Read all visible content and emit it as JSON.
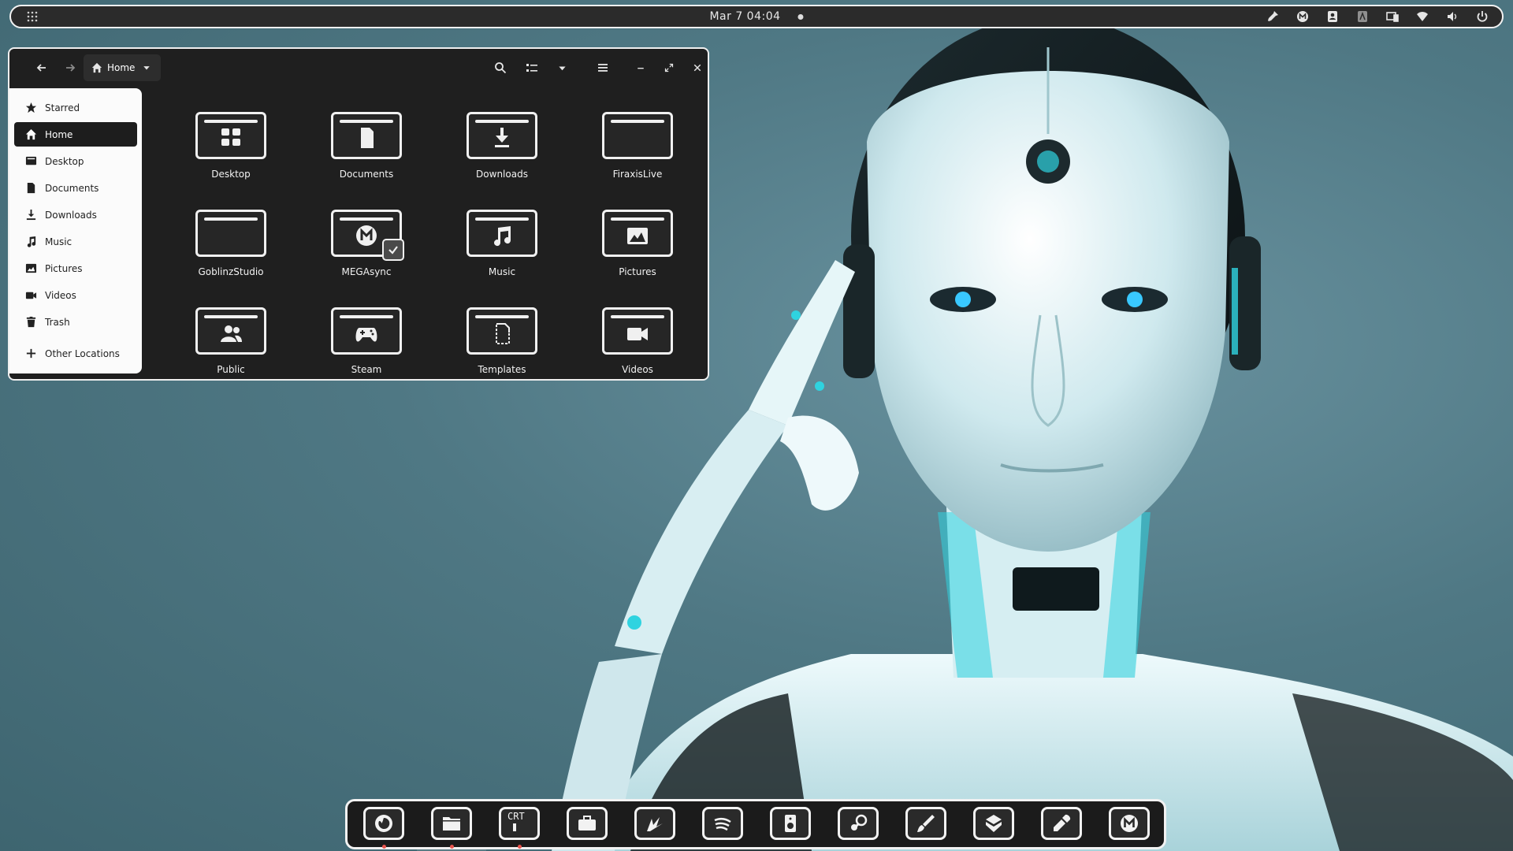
{
  "topbar": {
    "clock": "Mar 7  04:04",
    "tray_icons": [
      "tools-icon",
      "mega-icon",
      "contacts-icon",
      "keyboard-icon",
      "screen-icon",
      "wifi-icon",
      "volume-icon",
      "power-icon"
    ]
  },
  "window": {
    "path_label": "Home",
    "sidebar": [
      {
        "label": "Starred",
        "icon": "star-icon"
      },
      {
        "label": "Home",
        "icon": "home-icon",
        "active": true
      },
      {
        "label": "Desktop",
        "icon": "desktop-icon"
      },
      {
        "label": "Documents",
        "icon": "document-icon"
      },
      {
        "label": "Downloads",
        "icon": "download-icon"
      },
      {
        "label": "Music",
        "icon": "music-icon"
      },
      {
        "label": "Pictures",
        "icon": "picture-icon"
      },
      {
        "label": "Videos",
        "icon": "video-icon"
      },
      {
        "label": "Trash",
        "icon": "trash-icon"
      },
      {
        "label": "Other Locations",
        "icon": "plus-icon"
      }
    ],
    "folders": [
      {
        "label": "Desktop"
      },
      {
        "label": "Documents"
      },
      {
        "label": "Downloads"
      },
      {
        "label": "FiraxisLive"
      },
      {
        "label": "GoblinzStudio"
      },
      {
        "label": "MEGAsync"
      },
      {
        "label": "Music"
      },
      {
        "label": "Pictures"
      },
      {
        "label": "Public"
      },
      {
        "label": "Steam"
      },
      {
        "label": "Templates"
      },
      {
        "label": "Videos"
      }
    ]
  },
  "dock": {
    "crt_label": "CRT",
    "items": [
      "firefox-icon",
      "files-icon",
      "terminal-icon",
      "briefcase-icon",
      "inkscape-icon",
      "spotify-icon",
      "speaker-icon",
      "steam-icon",
      "brush-icon",
      "software-icon",
      "color-picker-icon",
      "mega-icon"
    ]
  },
  "colors": {
    "panel_bg": "#2b2b2b",
    "window_bg": "#1f1f1f",
    "sidebar_bg": "#fbfbfb",
    "accent_cyan": "#2fd3e0",
    "running_dot": "#e8554e"
  }
}
